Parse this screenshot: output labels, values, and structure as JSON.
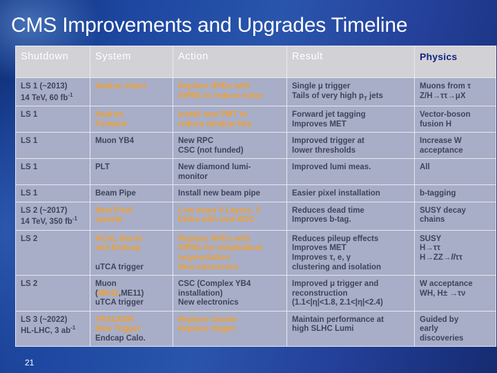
{
  "slide": {
    "title": "CMS Improvements and Upgrades Timeline",
    "slide_number": "21",
    "accent_color": "#16257e",
    "highlight_color": "#f0a030",
    "text_color": "#3e4459",
    "background_color": "#1f3a8c",
    "table_bg_color": "#a8aec8",
    "header_bg_color": "#d2d2d6"
  },
  "table": {
    "headers": [
      "Shutdown",
      "System",
      "Action",
      "Result",
      "Physics"
    ],
    "rows": [
      {
        "shutdown": {
          "l1": "LS 1 (~2013)",
          "l2": "14 TeV, 60 fb",
          "sup": "-1"
        },
        "system": {
          "l1": "Hadron Outer",
          "color": "orange"
        },
        "action": {
          "l1": "Replace HPDs with",
          "l2": "SiPMs to reduce noise",
          "color": "orange"
        },
        "result": {
          "l1": "Single μ trigger",
          "l2": "Tails of very high p",
          "l2sub": "T",
          "l2b": " jets"
        },
        "physics": {
          "l1": "Muons from  τ",
          "l2": "Z/H→ττ→μX"
        }
      },
      {
        "shutdown": {
          "l1": "LS 1"
        },
        "system": {
          "l1": "Hadron",
          "l2": "Forward",
          "color": "orange"
        },
        "action": {
          "l1": "Install new PMT to",
          "l2": "reduce window hits",
          "color": "orange"
        },
        "result": {
          "l1": "Forward jet tagging",
          "l2": "Improves MET"
        },
        "physics": {
          "l1": " Vector-boson",
          "l2": "fusion H"
        }
      },
      {
        "shutdown": {
          "l1": "LS 1"
        },
        "system": {
          "l1": "Muon YB4",
          "color": "dark"
        },
        "action": {
          "l1": "New RPC",
          "l2": "CSC (not funded)",
          "color": "dark"
        },
        "result": {
          "l1": "Improved trigger at",
          "l2": "lower thresholds"
        },
        "physics": {
          "l1": "Increase W",
          "l2": "acceptance"
        }
      },
      {
        "shutdown": {
          "l1": "LS 1"
        },
        "system": {
          "l1": "PLT",
          "color": "dark"
        },
        "action": {
          "l1": "New diamond lumi-",
          "l2": "monitor",
          "color": "dark"
        },
        "result": {
          "l1": "Improved lumi meas."
        },
        "physics": {
          "l1": "All"
        }
      },
      {
        "shutdown": {
          "l1": "LS 1"
        },
        "system": {
          "l1": "Beam Pipe",
          "color": "dark"
        },
        "action": {
          "l1": "Install new beam pipe",
          "color": "dark"
        },
        "result": {
          "l1": "Easier pixel installation"
        },
        "physics": {
          "l1": "b-tagging"
        }
      },
      {
        "shutdown": {
          "l1": "LS 2 (~2017)",
          "l2": "14 TeV, 350 fb",
          "sup": "-1"
        },
        "system": {
          "l1": "New Pixel",
          "l2": "system",
          "color": "orange"
        },
        "action": {
          "l1": "Low mass 4 Layers, 3",
          "l2": "Disks with new ROC",
          "color": "orange"
        },
        "result": {
          "l1": "Reduces dead time",
          "l2": "Improves b-tag."
        },
        "physics": {
          "l1": "SUSY decay",
          "l2": "chains"
        }
      },
      {
        "shutdown": {
          "l1": "LS 2"
        },
        "system": {
          "l1": "HCAL  Barrel",
          "l2": "and Endcap",
          "l3": "",
          "l4": "uTCA trigger",
          "color": "orange"
        },
        "action": {
          "l1": "Replace HPDs with",
          "l2": "SiPMs  for longitudinal",
          "l3": "segmentation",
          "l4": "New electronics",
          "color": "orange"
        },
        "result": {
          "l1": "Reduces pileup effects",
          "l2": "Improves MET",
          "l3": "Improves τ, e, γ",
          "l4": "clustering and isolation"
        },
        "physics": {
          "l1": "SUSY",
          "l2": "H→ττ",
          "l3": "H→ZZ→llττ"
        }
      },
      {
        "shutdown": {
          "l1": "LS 2"
        },
        "system": {
          "l1": "Muon",
          "l2pre": "(",
          "l2mid": "ME42",
          "l2post": ",ME11)",
          "l3": "uTCA trigger",
          "color": "dark"
        },
        "action": {
          "l1": "CSC (Complex YB4",
          "l2": "installation)",
          "l3": "New electronics",
          "color": "dark"
        },
        "result": {
          "l1": "Improved μ  trigger and",
          "l2": "reconstruction",
          "l3": "(1.1<|η|<1.8, 2.1<|η|<2.4)"
        },
        "physics": {
          "l1": "W acceptance",
          "l2": "WH, H± →τν"
        }
      },
      {
        "shutdown": {
          "l1": "LS 3 (~2022)",
          "l2": "HL-LHC, 3 ab",
          "sup": "-1"
        },
        "system": {
          "l1": "TRACKER",
          "l2": "New Trigger",
          "l3": "Endcap Calo.",
          "color": "orange"
        },
        "action": {
          "l1": "Replace tracker",
          "l2": "Replace trigger",
          "color": "orange"
        },
        "result": {
          "l1": "Maintain performance at",
          "l2": "high SLHC Lumi"
        },
        "physics": {
          "l1": "Guided by",
          "l2": "early",
          "l3": "discoveries"
        }
      }
    ]
  }
}
